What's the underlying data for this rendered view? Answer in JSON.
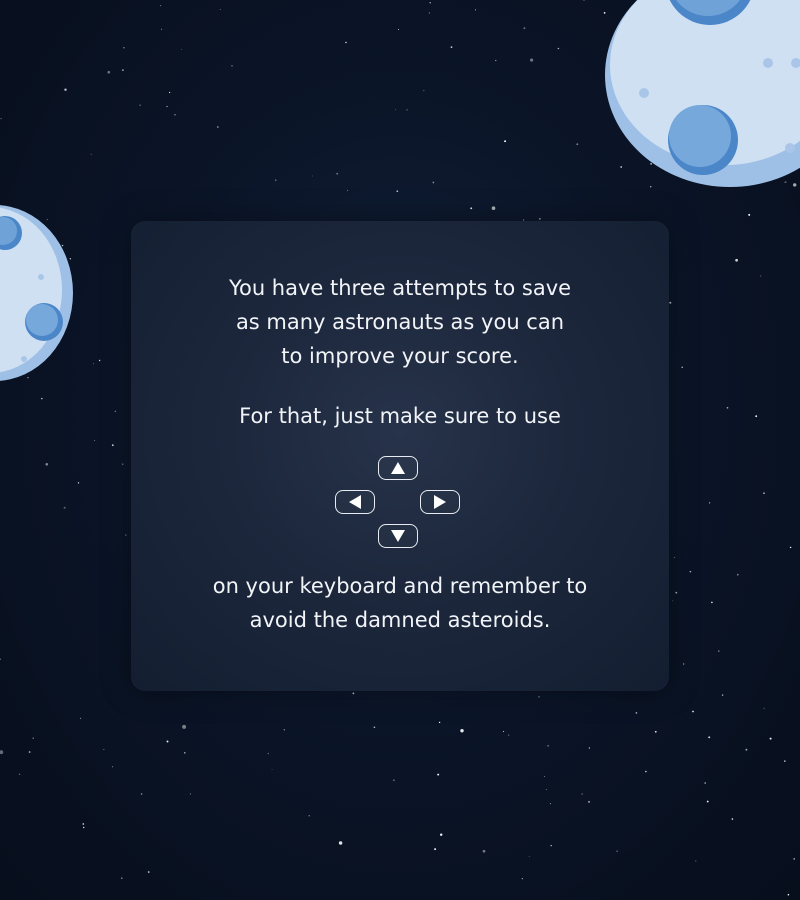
{
  "instructions": {
    "intro_lines": [
      "You have three attempts to save",
      "as many astronauts as you can",
      "to improve your score."
    ],
    "use_line": "For that, just make sure to use",
    "outro_lines": [
      "on your keyboard and remember to",
      "avoid the damned asteroids."
    ]
  },
  "keys": [
    {
      "name": "up",
      "icon": "arrow-up-icon"
    },
    {
      "name": "left",
      "icon": "arrow-left-icon"
    },
    {
      "name": "right",
      "icon": "arrow-right-icon"
    },
    {
      "name": "down",
      "icon": "arrow-down-icon"
    }
  ],
  "colors": {
    "background": "#0b1528",
    "panel": "#1c273c",
    "text": "#f2f4f8",
    "asteroid_light": "#cfe0f3",
    "asteroid_shadow": "#9fc0e6",
    "crater": "#5b93d0"
  }
}
